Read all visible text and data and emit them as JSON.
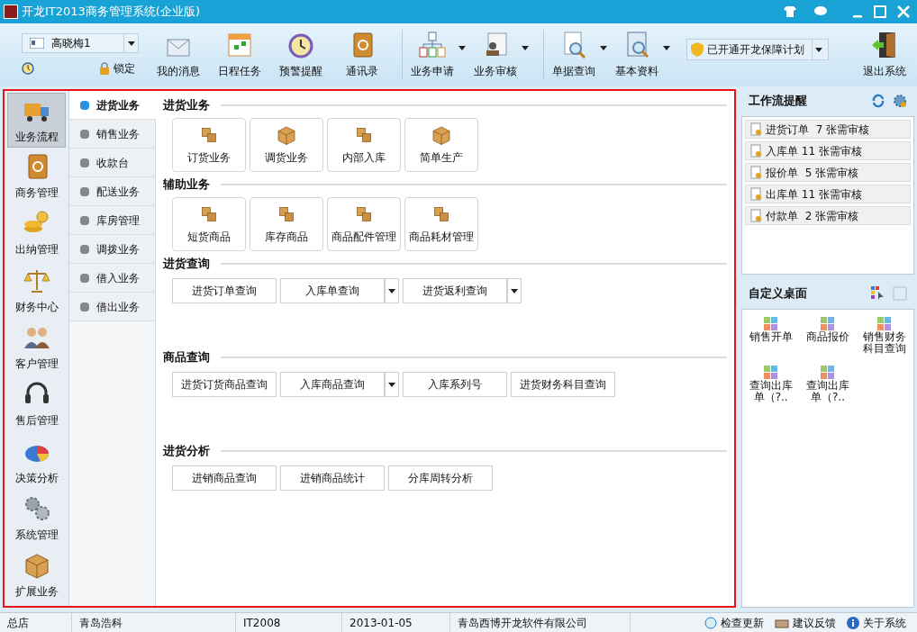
{
  "window": {
    "title": "开龙IT2013商务管理系统(企业版)"
  },
  "toolbar": {
    "user": "高晓梅1",
    "lock": "锁定",
    "items": [
      {
        "label": "我的消息",
        "kind": "mail",
        "dropdown": false
      },
      {
        "label": "日程任务",
        "kind": "calendar",
        "dropdown": false
      },
      {
        "label": "预警提醒",
        "kind": "clock",
        "dropdown": false
      },
      {
        "label": "通讯录",
        "kind": "book",
        "dropdown": false
      },
      {
        "label": "业务申请",
        "kind": "org",
        "dropdown": true
      },
      {
        "label": "业务审核",
        "kind": "stamp",
        "dropdown": true
      },
      {
        "label": "单据查询",
        "kind": "search",
        "dropdown": true
      },
      {
        "label": "基本资料",
        "kind": "notebook",
        "dropdown": true
      }
    ],
    "guarantee": "已开通开龙保障计划",
    "exit": "退出系统"
  },
  "sidebar": [
    {
      "label": "业务流程",
      "kind": "truck",
      "selected": true
    },
    {
      "label": "商务管理",
      "kind": "book",
      "selected": false
    },
    {
      "label": "出纳管理",
      "kind": "coins",
      "selected": false
    },
    {
      "label": "财务中心",
      "kind": "scale",
      "selected": false
    },
    {
      "label": "客户管理",
      "kind": "people",
      "selected": false
    },
    {
      "label": "售后管理",
      "kind": "headset",
      "selected": false
    },
    {
      "label": "决策分析",
      "kind": "pie",
      "selected": false
    },
    {
      "label": "系统管理",
      "kind": "gears",
      "selected": false
    },
    {
      "label": "扩展业务",
      "kind": "box",
      "selected": false
    }
  ],
  "subnav": [
    {
      "label": "进货业务",
      "selected": true
    },
    {
      "label": "销售业务",
      "selected": false
    },
    {
      "label": "收款台",
      "selected": false
    },
    {
      "label": "配送业务",
      "selected": false
    },
    {
      "label": "库房管理",
      "selected": false
    },
    {
      "label": "调拨业务",
      "selected": false
    },
    {
      "label": "借入业务",
      "selected": false
    },
    {
      "label": "借出业务",
      "selected": false
    }
  ],
  "sections": [
    {
      "title": "进货业务",
      "kind": "tiles",
      "items": [
        {
          "label": "订货业务"
        },
        {
          "label": "调货业务"
        },
        {
          "label": "内部入库"
        },
        {
          "label": "简单生产"
        }
      ]
    },
    {
      "title": "辅助业务",
      "kind": "tiles",
      "items": [
        {
          "label": "短货商品"
        },
        {
          "label": "库存商品"
        },
        {
          "label": "商品配件管理"
        },
        {
          "label": "商品耗材管理"
        }
      ]
    },
    {
      "title": "进货查询",
      "kind": "buttons",
      "items": [
        {
          "label": "进货订单查询",
          "dropdown": false
        },
        {
          "label": "入库单查询",
          "dropdown": true
        },
        {
          "label": "进货返利查询",
          "dropdown": true
        }
      ]
    },
    {
      "title": "商品查询",
      "kind": "buttons",
      "items": [
        {
          "label": "进货订货商品查询",
          "dropdown": false
        },
        {
          "label": "入库商品查询",
          "dropdown": true
        },
        {
          "label": "入库系列号",
          "dropdown": false
        },
        {
          "label": "进货财务科目查询",
          "dropdown": false
        }
      ]
    },
    {
      "title": "进货分析",
      "kind": "buttons",
      "items": [
        {
          "label": "进销商品查询",
          "dropdown": false
        },
        {
          "label": "进销商品统计",
          "dropdown": false
        },
        {
          "label": "分库周转分析",
          "dropdown": false
        }
      ]
    }
  ],
  "workflow": {
    "title": "工作流提醒",
    "items": [
      "进货订单  7 张需审核",
      "入库单 11 张需审核",
      "报价单  5 张需审核",
      "出库单 11 张需审核",
      "付款单  2 张需审核"
    ]
  },
  "desktop": {
    "title": "自定义桌面",
    "items": [
      "销售开单",
      "商品报价",
      "销售财务科目查询",
      "查询出库单（?..",
      "查询出库单（?.."
    ]
  },
  "status_bar": {
    "cells": [
      "总店",
      "青岛浩科",
      "IT2008",
      "2013-01-05",
      "青岛西博开龙软件有限公司"
    ],
    "links": [
      {
        "label": "检查更新",
        "kind": "refresh"
      },
      {
        "label": "建议反馈",
        "kind": "feedback"
      },
      {
        "label": "关于系统",
        "kind": "info"
      }
    ]
  }
}
